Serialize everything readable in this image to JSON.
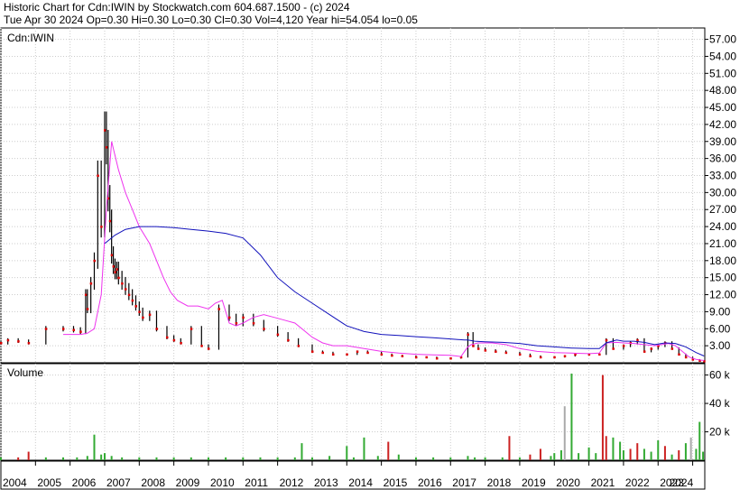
{
  "header": {
    "line1": "Historic Chart for Cdn:IWIN by Stockwatch.com 604.687.1500 - (c) 2024",
    "line2": "Tue Apr 30 2024  Op=0.30  Hi=0.30  Lo=0.30  Cl=0.30  Vol=4,120  Year hi=54.054  lo=0.05"
  },
  "colors": {
    "price_bar": "#000000",
    "close_marker": "#dd0000",
    "ma_short": "#ee33ee",
    "ma_long": "#1111bb",
    "volume_up": "#33aa33",
    "volume_down": "#cc2222",
    "volume_flat": "#aaaaaa",
    "grid": "#cccccc"
  },
  "chart_data": [
    {
      "type": "line",
      "panel": "price",
      "label": "Cdn:IWIN",
      "xlim": [
        2004.0,
        2024.35
      ],
      "ylim": [
        0,
        59
      ],
      "y_ticks": [
        "57.00",
        "54.00",
        "51.00",
        "48.00",
        "45.00",
        "42.00",
        "39.00",
        "36.00",
        "33.00",
        "30.00",
        "27.00",
        "24.00",
        "21.00",
        "18.00",
        "15.00",
        "12.00",
        "9.00",
        "6.00",
        "3.00"
      ],
      "x_ticks": [
        "2004",
        "2005",
        "2006",
        "2007",
        "2008",
        "2009",
        "2010",
        "2011",
        "2012",
        "2013",
        "2014",
        "2015",
        "2016",
        "2017",
        "2018",
        "2019",
        "2020",
        "2021",
        "2022",
        "2023",
        "2024"
      ],
      "grid": true,
      "series": [
        {
          "role": "close",
          "x": [
            2004.0,
            2004.2,
            2004.5,
            2004.8,
            2005.3,
            2005.8,
            2006.1,
            2006.3,
            2006.45,
            2006.5,
            2006.6,
            2006.7,
            2006.8,
            2006.9,
            2007.0,
            2007.05,
            2007.1,
            2007.15,
            2007.2,
            2007.25,
            2007.3,
            2007.35,
            2007.4,
            2007.5,
            2007.6,
            2007.7,
            2007.8,
            2007.9,
            2008.0,
            2008.1,
            2008.3,
            2008.5,
            2008.8,
            2009.0,
            2009.2,
            2009.5,
            2009.8,
            2010.0,
            2010.3,
            2010.6,
            2010.8,
            2011.0,
            2011.3,
            2011.6,
            2012.0,
            2012.3,
            2012.6,
            2013.0,
            2013.3,
            2013.6,
            2014.0,
            2014.3,
            2014.6,
            2015.0,
            2015.3,
            2015.6,
            2016.0,
            2016.3,
            2016.6,
            2017.0,
            2017.3,
            2017.5,
            2017.65,
            2017.8,
            2018.0,
            2018.3,
            2018.6,
            2019.0,
            2019.3,
            2019.6,
            2020.0,
            2020.3,
            2020.6,
            2021.0,
            2021.3,
            2021.5,
            2021.7,
            2022.0,
            2022.2,
            2022.4,
            2022.6,
            2022.8,
            2023.0,
            2023.2,
            2023.4,
            2023.6,
            2023.8,
            2024.0,
            2024.2,
            2024.33
          ],
          "values": [
            3.5,
            4.0,
            3.8,
            3.5,
            6.0,
            6.0,
            5.8,
            5.5,
            12.0,
            9.5,
            14.0,
            18.0,
            33.0,
            24.0,
            41.0,
            38.0,
            29.0,
            25.0,
            19.0,
            17.0,
            16.0,
            16.5,
            15.0,
            14.0,
            13.0,
            12.0,
            11.0,
            10.0,
            9.0,
            8.0,
            8.5,
            6.0,
            4.5,
            4.0,
            3.5,
            6.0,
            3.0,
            2.5,
            9.5,
            8.0,
            7.0,
            8.0,
            7.0,
            6.0,
            5.0,
            4.0,
            3.0,
            2.0,
            1.8,
            1.5,
            1.5,
            2.0,
            1.8,
            1.5,
            1.3,
            1.2,
            1.0,
            1.0,
            0.8,
            0.8,
            1.0,
            5.0,
            3.0,
            2.5,
            2.2,
            2.0,
            1.8,
            1.5,
            1.2,
            1.0,
            1.0,
            1.2,
            1.5,
            1.5,
            1.5,
            4.0,
            2.5,
            3.0,
            3.5,
            4.0,
            2.0,
            2.5,
            3.0,
            3.5,
            2.5,
            1.5,
            1.0,
            0.6,
            0.4,
            0.3
          ]
        },
        {
          "role": "ma_short",
          "x": [
            2005.8,
            2006.0,
            2006.3,
            2006.5,
            2006.7,
            2006.9,
            2007.05,
            2007.2,
            2007.4,
            2007.6,
            2007.8,
            2008.0,
            2008.3,
            2008.5,
            2008.7,
            2008.9,
            2009.1,
            2009.4,
            2009.7,
            2010.0,
            2010.2,
            2010.4,
            2010.6,
            2010.8,
            2011.0,
            2011.3,
            2011.6,
            2011.9,
            2012.2,
            2012.5,
            2012.8,
            2013.0,
            2013.3,
            2013.6,
            2014.0,
            2014.5,
            2015.0,
            2015.5,
            2016.0,
            2016.5,
            2017.0,
            2017.3,
            2017.5,
            2017.6,
            2017.8,
            2018.2,
            2018.6,
            2019.0,
            2019.5,
            2020.0,
            2020.5,
            2021.0,
            2021.3,
            2021.5,
            2021.8,
            2022.0,
            2022.3,
            2022.6,
            2022.9,
            2023.1,
            2023.3,
            2023.5,
            2023.7,
            2023.9,
            2024.1,
            2024.33
          ],
          "values": [
            5.0,
            5.0,
            5.0,
            5.2,
            6.0,
            12.0,
            27.0,
            39.0,
            34.0,
            30.0,
            27.0,
            24.0,
            21.0,
            18.0,
            15.0,
            12.5,
            11.0,
            10.0,
            10.0,
            9.5,
            10.5,
            11.0,
            7.0,
            6.5,
            7.0,
            8.0,
            8.5,
            8.0,
            7.5,
            7.0,
            5.5,
            4.5,
            3.5,
            3.0,
            3.0,
            2.5,
            2.0,
            1.7,
            1.5,
            1.4,
            1.3,
            1.1,
            2.8,
            3.2,
            3.5,
            3.5,
            3.2,
            2.5,
            2.0,
            1.8,
            1.7,
            1.6,
            1.7,
            3.5,
            3.6,
            3.5,
            3.4,
            3.2,
            3.0,
            3.2,
            3.4,
            3.0,
            2.0,
            1.0,
            0.6,
            0.4
          ]
        },
        {
          "role": "ma_long",
          "x": [
            2007.0,
            2007.3,
            2007.6,
            2008.0,
            2008.5,
            2009.0,
            2009.5,
            2010.0,
            2010.5,
            2011.0,
            2011.5,
            2012.0,
            2012.5,
            2013.0,
            2013.5,
            2014.0,
            2014.5,
            2015.0,
            2015.5,
            2016.0,
            2016.5,
            2017.0,
            2017.4,
            2017.5,
            2017.7,
            2018.0,
            2018.5,
            2019.0,
            2019.5,
            2020.0,
            2020.5,
            2021.0,
            2021.3,
            2021.5,
            2021.8,
            2022.0,
            2022.3,
            2022.6,
            2022.9,
            2023.2,
            2023.5,
            2023.8,
            2024.1,
            2024.33
          ],
          "values": [
            21.0,
            22.5,
            23.5,
            24.0,
            24.0,
            23.8,
            23.5,
            23.2,
            22.8,
            22.0,
            19.0,
            15.0,
            12.5,
            10.5,
            8.5,
            6.5,
            5.5,
            5.0,
            4.8,
            4.6,
            4.4,
            4.2,
            4.0,
            4.0,
            3.8,
            3.7,
            3.6,
            3.4,
            3.0,
            2.8,
            2.6,
            2.5,
            2.5,
            3.5,
            4.0,
            3.8,
            3.8,
            3.6,
            3.2,
            3.5,
            3.4,
            2.8,
            1.8,
            1.2
          ]
        }
      ]
    },
    {
      "type": "bar",
      "panel": "volume",
      "label": "Volume",
      "ylim": [
        0,
        68
      ],
      "y_ticks": [
        "60 k",
        "40 k",
        "20 k"
      ],
      "x": [
        2004.0,
        2004.5,
        2004.8,
        2005.3,
        2005.8,
        2006.2,
        2006.5,
        2006.7,
        2006.9,
        2007.0,
        2007.2,
        2007.5,
        2008.0,
        2008.5,
        2009.0,
        2009.5,
        2010.0,
        2010.5,
        2011.0,
        2011.5,
        2012.0,
        2012.5,
        2012.7,
        2013.0,
        2013.5,
        2014.0,
        2014.2,
        2014.5,
        2014.9,
        2015.2,
        2015.5,
        2016.0,
        2016.5,
        2017.0,
        2017.5,
        2017.7,
        2018.0,
        2018.5,
        2018.7,
        2019.0,
        2019.3,
        2019.6,
        2019.9,
        2020.0,
        2020.2,
        2020.3,
        2020.5,
        2020.7,
        2021.0,
        2021.2,
        2021.4,
        2021.5,
        2021.7,
        2021.9,
        2022.0,
        2022.2,
        2022.4,
        2022.6,
        2022.8,
        2023.0,
        2023.2,
        2023.4,
        2023.6,
        2023.8,
        2023.95,
        2024.1,
        2024.2,
        2024.3
      ],
      "values": [
        2,
        2,
        6,
        2,
        2,
        2,
        3,
        18,
        4,
        5,
        3,
        2,
        2,
        2,
        2,
        2,
        2,
        2,
        2,
        2,
        2,
        2,
        12,
        2,
        3,
        10,
        2,
        16,
        3,
        13,
        4,
        2,
        2,
        2,
        3,
        2,
        2,
        2,
        17,
        2,
        4,
        8,
        3,
        5,
        7,
        38,
        61,
        5,
        9,
        5,
        60,
        17,
        16,
        13,
        7,
        8,
        12,
        8,
        6,
        14,
        10,
        4,
        7,
        12,
        16,
        8,
        27,
        6
      ],
      "direction": [
        "u",
        "d",
        "d",
        "u",
        "u",
        "u",
        "u",
        "u",
        "u",
        "u",
        "u",
        "u",
        "u",
        "u",
        "u",
        "u",
        "u",
        "u",
        "u",
        "u",
        "u",
        "u",
        "u",
        "u",
        "u",
        "u",
        "u",
        "u",
        "u",
        "d",
        "u",
        "u",
        "u",
        "u",
        "u",
        "u",
        "u",
        "u",
        "d",
        "u",
        "d",
        "d",
        "u",
        "u",
        "u",
        "f",
        "u",
        "u",
        "u",
        "u",
        "d",
        "d",
        "u",
        "u",
        "u",
        "d",
        "d",
        "u",
        "u",
        "u",
        "d",
        "u",
        "d",
        "u",
        "f",
        "u",
        "u",
        "u"
      ]
    }
  ]
}
